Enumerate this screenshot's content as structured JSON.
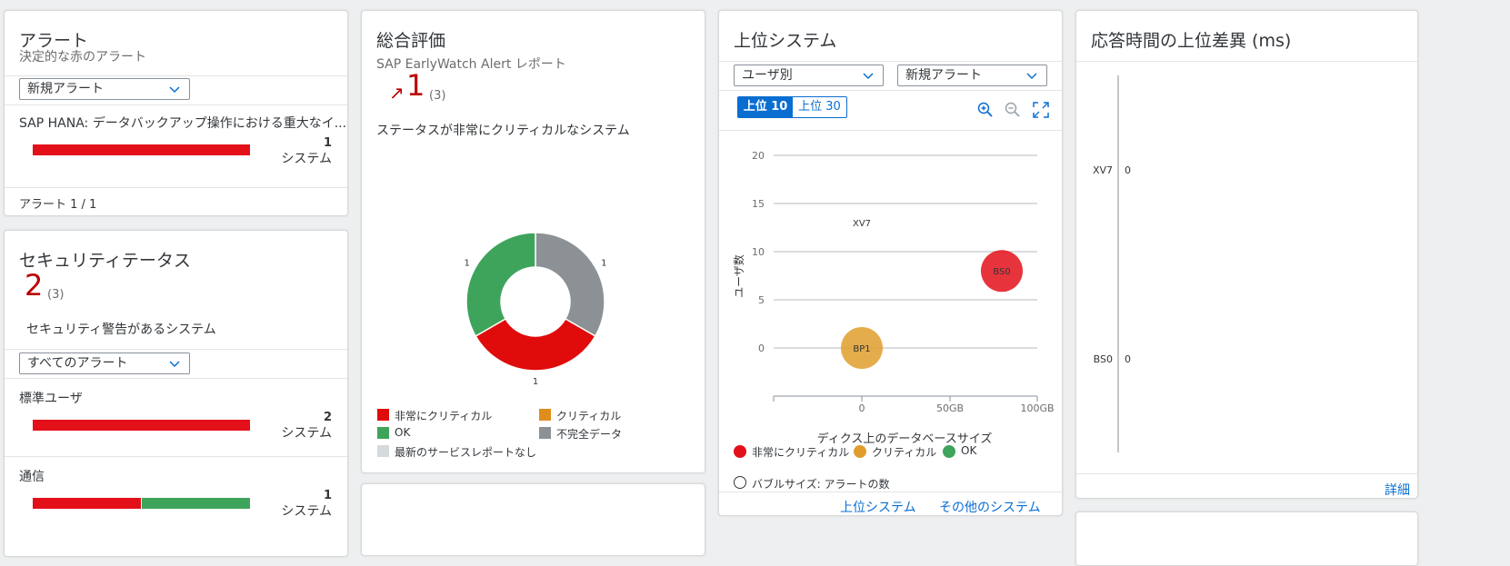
{
  "alerts": {
    "title": "アラート",
    "subtitle": "決定的な赤のアラート",
    "filter": "新規アラート",
    "item_label": "SAP HANA: データバックアップ操作における重大なイ...",
    "item_count": "1",
    "item_unit": "システム",
    "footer": "アラート 1 / 1"
  },
  "security": {
    "title": "セキュリティテータス",
    "kpi_value": "2",
    "kpi_total": "(3)",
    "description": "セキュリティ警告があるシステム",
    "filter": "すべてのアラート",
    "items": [
      {
        "label": "標準ユーザ",
        "count": "2",
        "unit": "システム",
        "red_fraction": 1.0
      },
      {
        "label": "通信",
        "count": "1",
        "unit": "システム",
        "red_fraction": 0.5
      }
    ]
  },
  "overall": {
    "title": "総合評価",
    "subtitle": "SAP EarlyWatch Alert レポート",
    "trend_arrow": "↗",
    "kpi_value": "1",
    "kpi_total": "(3)",
    "description": "ステータスが非常にクリティカルなシステム",
    "legend": [
      {
        "label": "非常にクリティカル",
        "color": "#e00b0b"
      },
      {
        "label": "クリティカル",
        "color": "#df8e1d"
      },
      {
        "label": "OK",
        "color": "#3fa45b"
      },
      {
        "label": "不完全データ",
        "color": "#8c9196"
      },
      {
        "label": "最新のサービスレポートなし",
        "color": "#d5dadd"
      }
    ]
  },
  "top_systems": {
    "title": "上位システム",
    "filter1": "ユーザ別",
    "filter2": "新規アラート",
    "toggle_top10": "上位 10",
    "toggle_top30": "上位 30",
    "legend": [
      {
        "label": "非常にクリティカル",
        "color": "#e3101a"
      },
      {
        "label": "クリティカル",
        "color": "#e09d2b"
      },
      {
        "label": "OK",
        "color": "#3fa45b"
      }
    ],
    "bubble_size_label": "バブルサイズ: アラートの数",
    "link_top": "上位システム",
    "link_other": "その他のシステム"
  },
  "response": {
    "title": "応答時間の上位差異 (ms)",
    "details_link": "詳細"
  },
  "chart_data": [
    {
      "type": "pie",
      "categories": [
        "非常にクリティカル",
        "クリティカル",
        "OK",
        "不完全データ",
        "最新のサービスレポートなし"
      ],
      "values": [
        1,
        0,
        1,
        1,
        0
      ],
      "colors": [
        "#e00b0b",
        "#df8e1d",
        "#3fa45b",
        "#8c9196",
        "#d5dadd"
      ]
    },
    {
      "type": "scatter",
      "xlabel": "ディクス上のデータベースサイズ",
      "ylabel": "ユーザ数",
      "x_ticks": [
        "0",
        "50GB",
        "100GB"
      ],
      "y_ticks": [
        0,
        5,
        10,
        15,
        20
      ],
      "points": [
        {
          "label": "XV7",
          "x": 0,
          "y": 13,
          "category": "",
          "size": 0
        },
        {
          "label": "BS0",
          "x": 80,
          "y": 8,
          "category": "非常にクリティカル",
          "size": 1
        },
        {
          "label": "BP1",
          "x": 0,
          "y": 0,
          "category": "クリティカル",
          "size": 1
        }
      ]
    },
    {
      "type": "bar",
      "categories": [
        "XV7",
        "BS0"
      ],
      "values": [
        0,
        0
      ]
    }
  ]
}
